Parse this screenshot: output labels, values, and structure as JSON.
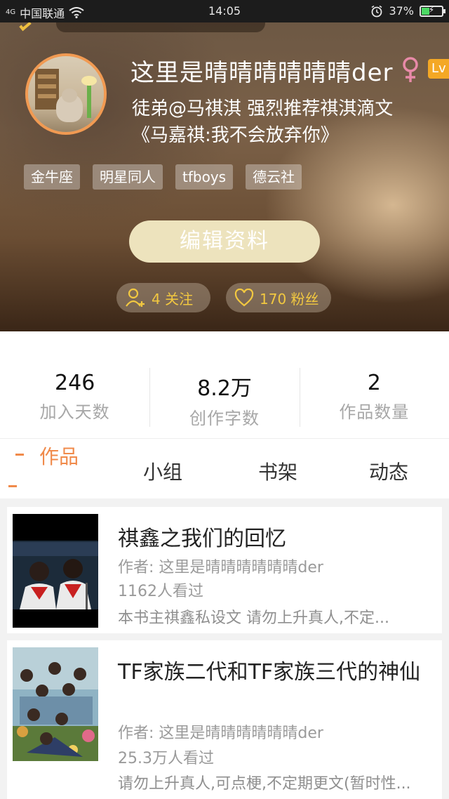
{
  "status_bar": {
    "signal": "4G",
    "carrier": "中国联通",
    "time": "14:05",
    "battery": "37%",
    "battery_level": 0.37,
    "colors": {
      "battery_fill": "#4cd964"
    }
  },
  "profile": {
    "username": "这里是晴晴晴晴晴晴der",
    "level": "Lv",
    "bio_line1": "徒弟@马祺淇 强烈推荐祺淇滴文",
    "bio_line2": "《马嘉祺:我不会放弃你》",
    "tags": [
      "金牛座",
      "明星同人",
      "tfboys",
      "德云社"
    ],
    "edit_button": "编辑资料",
    "following_text": "4 关注",
    "fans_text": "170 粉丝",
    "colors": {
      "gender": "#e88aa8",
      "level_badge": "#f4a825",
      "accent": "#f2c840"
    }
  },
  "stats": [
    {
      "value": "246",
      "label": "加入天数"
    },
    {
      "value": "8.2万",
      "label": "创作字数"
    },
    {
      "value": "2",
      "label": "作品数量"
    }
  ],
  "tabs": [
    "作品",
    "小组",
    "书架",
    "动态"
  ],
  "active_tab": "作品",
  "works": [
    {
      "title": "祺鑫之我们的回忆",
      "author": "作者: 这里是晴晴晴晴晴晴der",
      "views": "1162人看过",
      "description": "本书主祺鑫私设文 请勿上升真人,不定..."
    },
    {
      "title": "TF家族二代和TF家族三代的神仙",
      "author": "作者: 这里是晴晴晴晴晴晴der",
      "views": "25.3万人看过",
      "description": "请勿上升真人,可点梗,不定期更文(暂时性..."
    }
  ]
}
